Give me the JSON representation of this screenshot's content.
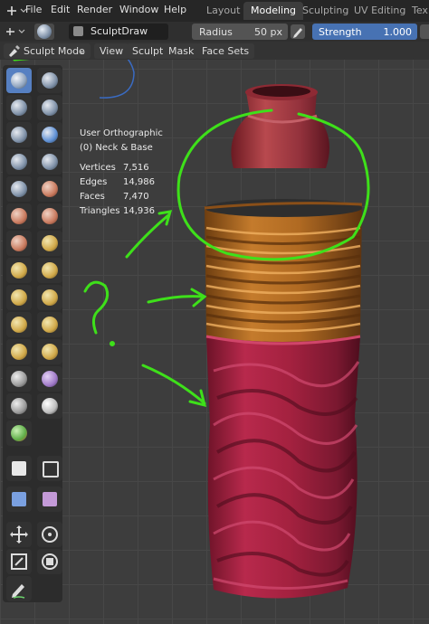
{
  "menu": {
    "file": "File",
    "edit": "Edit",
    "render": "Render",
    "window": "Window",
    "help": "Help"
  },
  "workspaces": [
    "Layout",
    "Modeling",
    "Sculpting",
    "UV Editing",
    "Tex"
  ],
  "active_workspace": "Modeling",
  "tool_header": {
    "brush_name": "SculptDraw",
    "radius_label": "Radius",
    "radius_value": "50 px",
    "strength_label": "Strength",
    "strength_value": "1.000"
  },
  "header": {
    "mode": "Sculpt Mode",
    "view": "View",
    "sculpt": "Sculpt",
    "mask": "Mask",
    "face_sets": "Face Sets"
  },
  "viewport_info": {
    "view_name": "User Orthographic",
    "object_name": "(0) Neck & Base",
    "stats": [
      {
        "label": "Vertices",
        "value": "7,516"
      },
      {
        "label": "Edges",
        "value": "14,986"
      },
      {
        "label": "Faces",
        "value": "7,470"
      },
      {
        "label": "Triangles",
        "value": "14,936"
      }
    ]
  },
  "annotation": {
    "mark": "?",
    "color": "#3ee01a"
  },
  "colors": {
    "active_tab": "#3d3d3d",
    "accent_blue": "#5680c2",
    "bottle_red": "#a3213f",
    "bottle_orange": "#b06a22",
    "annotation_green": "#3ee01a"
  }
}
